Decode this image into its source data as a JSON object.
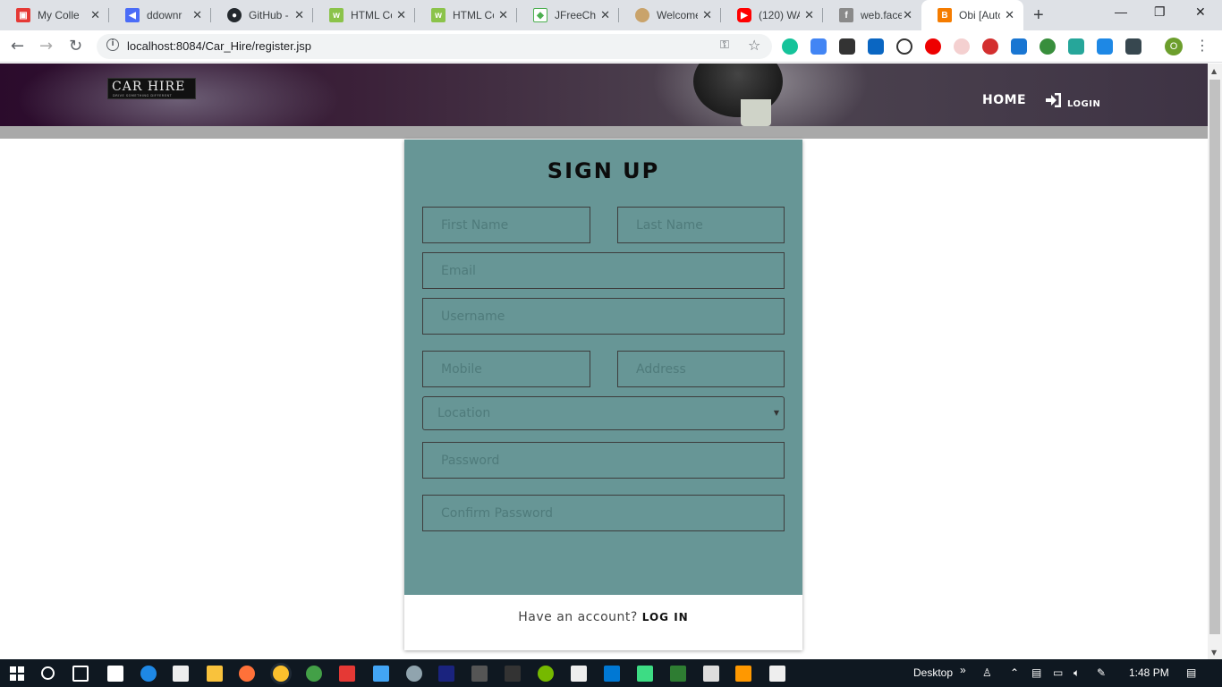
{
  "browser": {
    "tabs": [
      {
        "label": "My Colle",
        "icon": "collection-icon",
        "color": "#e53935"
      },
      {
        "label": "ddownr",
        "icon": "ddownr-icon",
        "color": "#4a6cf7"
      },
      {
        "label": "GitHub -",
        "icon": "github-icon",
        "color": "#24292e"
      },
      {
        "label": "HTML Co",
        "icon": "w3-icon",
        "color": "#8bc34a"
      },
      {
        "label": "HTML Co",
        "icon": "w3-icon",
        "color": "#8bc34a"
      },
      {
        "label": "JFreeCha",
        "icon": "jfree-icon",
        "color": "#4caf50"
      },
      {
        "label": "Welcome",
        "icon": "shell-icon",
        "color": "#c9a36b"
      },
      {
        "label": "(120) WA",
        "icon": "youtube-icon",
        "color": "#ff0000"
      },
      {
        "label": "web.facel",
        "icon": "facebook-icon",
        "color": "#8a8a8a"
      },
      {
        "label": "Obi [Auto",
        "icon": "blogger-icon",
        "color": "#f57c00"
      }
    ],
    "url": "localhost:8084/Car_Hire/register.jsp",
    "profile_initial": "O"
  },
  "site": {
    "logo_main": "CAR HIRE",
    "logo_tagline": "DRIVE SOMETHING DIFFERENT",
    "nav_home": "HOME",
    "nav_login": "LOGIN"
  },
  "form": {
    "title": "SIGN UP",
    "first_name_placeholder": "First Name",
    "last_name_placeholder": "Last Name",
    "email_placeholder": "Email",
    "username_placeholder": "Username",
    "mobile_placeholder": "Mobile",
    "address_placeholder": "Address",
    "location_value": "Location",
    "password_placeholder": "Password",
    "confirm_password_placeholder": "Confirm Password",
    "footer_text": "Have an account?",
    "footer_link": "LOG IN"
  },
  "taskbar": {
    "desktop_label": "Desktop",
    "time": "1:48 PM"
  },
  "colors": {
    "card": "#679696",
    "header_dark": "#2b0b2c",
    "grey_band": "#a9a9a9"
  }
}
